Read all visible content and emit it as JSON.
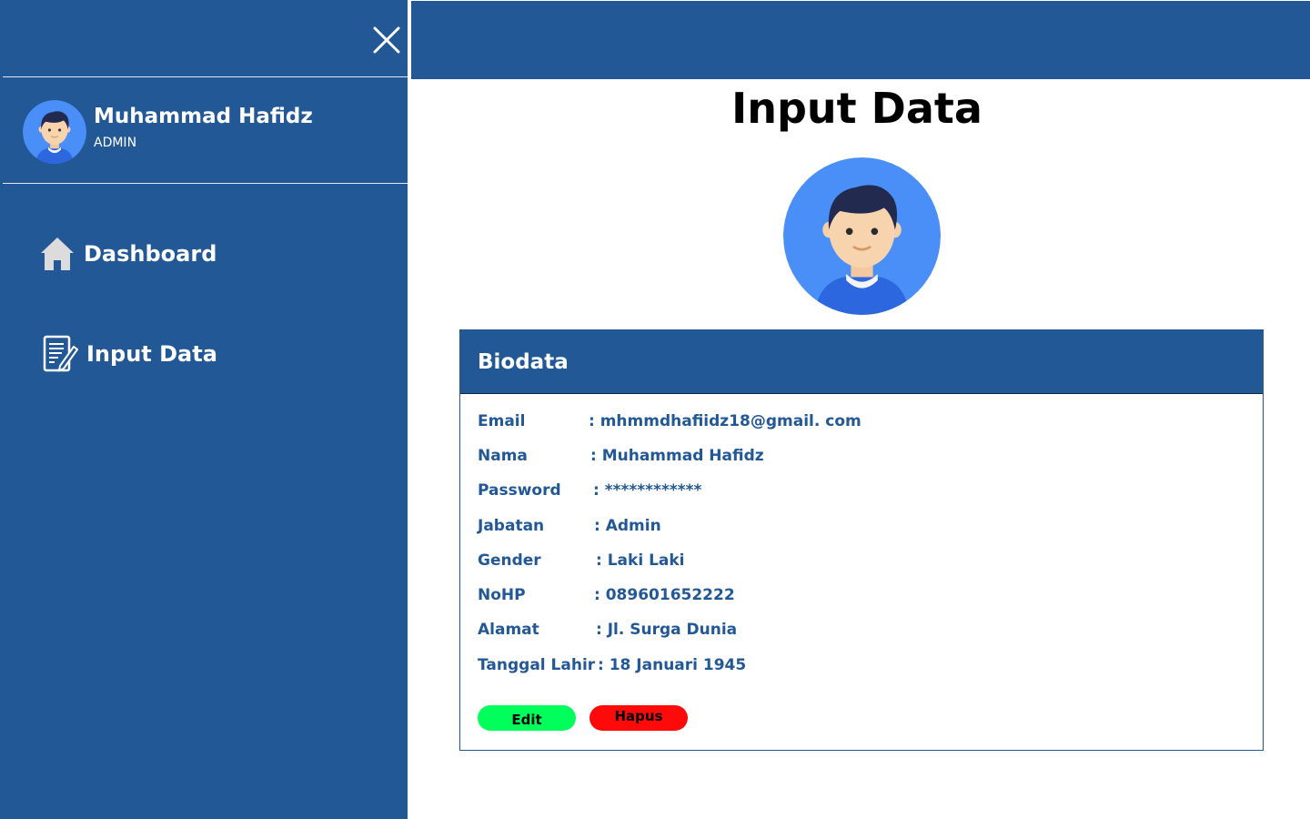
{
  "sidebar": {
    "user": {
      "name": "Muhammad Hafidz",
      "role": "ADMIN"
    },
    "nav": [
      {
        "label": "Dashboard",
        "icon": "home-icon"
      },
      {
        "label": "Input Data",
        "icon": "document-edit-icon"
      }
    ]
  },
  "main": {
    "title": "Input Data",
    "card": {
      "title": "Biodata",
      "fields": [
        {
          "label": "Email",
          "value": ":  mhmmdhafiidz18@gmail. com"
        },
        {
          "label": "Nama",
          "value": ":  Muhammad Hafidz"
        },
        {
          "label": "Password",
          "value": ":  ************"
        },
        {
          "label": "Jabatan",
          "value": ":  Admin"
        },
        {
          "label": "Gender",
          "value": ":  Laki Laki"
        },
        {
          "label": "NoHP",
          "value": ": 089601652222"
        },
        {
          "label": "Alamat",
          "value": ": Jl. Surga Dunia"
        },
        {
          "label": "Tanggal Lahir",
          "value": ":  18 Januari 1945"
        }
      ],
      "buttons": {
        "edit": "Edit",
        "delete": "Hapus"
      }
    }
  },
  "colors": {
    "primary": "#225896",
    "edit": "#00ff5a",
    "delete": "#ff0a0a",
    "avatar_bg": "#4a8ff7"
  }
}
